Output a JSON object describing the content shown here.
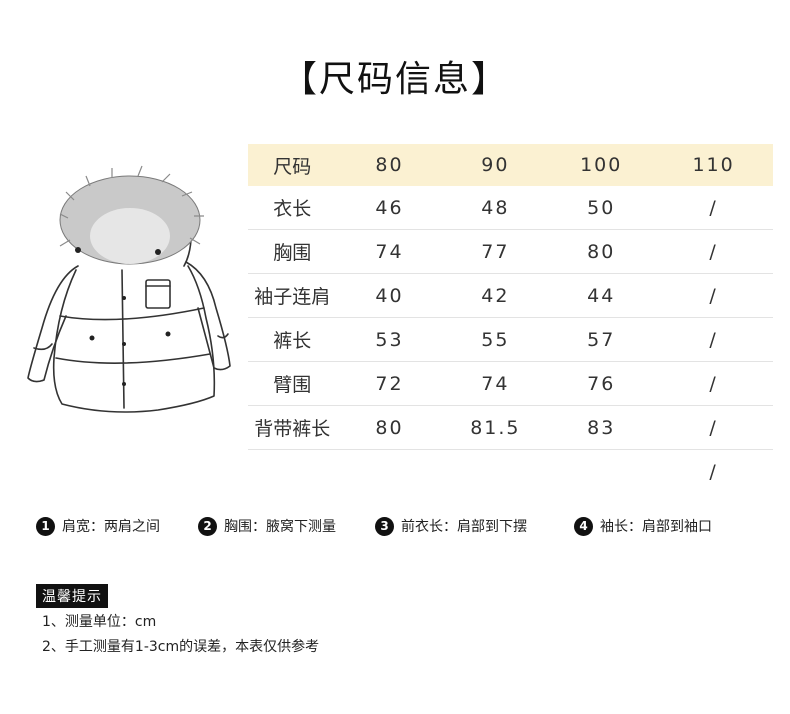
{
  "title": "【尺码信息】",
  "table": {
    "header": {
      "label": "尺码",
      "values": [
        "80",
        "90",
        "100",
        "110"
      ]
    },
    "rows": [
      {
        "label": "衣长",
        "values": [
          "46",
          "48",
          "50",
          "/"
        ]
      },
      {
        "label": "胸围",
        "values": [
          "74",
          "77",
          "80",
          "/"
        ]
      },
      {
        "label": "袖子连肩",
        "values": [
          "40",
          "42",
          "44",
          "/"
        ]
      },
      {
        "label": "裤长",
        "values": [
          "53",
          "55",
          "57",
          "/"
        ]
      },
      {
        "label": "臂围",
        "values": [
          "72",
          "74",
          "76",
          "/"
        ]
      },
      {
        "label": "背带裤长",
        "values": [
          "80",
          "81.5",
          "83",
          "/"
        ]
      },
      {
        "label": "",
        "values": [
          "",
          "",
          "",
          "/"
        ]
      }
    ],
    "header_bg": "#fbf1d2"
  },
  "measure_notes": [
    {
      "num": "1",
      "text": "肩宽：两肩之间"
    },
    {
      "num": "2",
      "text": "胸围：腋窝下测量"
    },
    {
      "num": "3",
      "text": "前衣长：肩部到下摆"
    },
    {
      "num": "4",
      "text": "袖长：肩部到袖口"
    }
  ],
  "tips": {
    "label": "温馨提示",
    "lines": [
      "1、测量单位：cm",
      "2、手工测量有1-3cm的误差，本表仅供参考"
    ]
  },
  "image": {
    "icon": "hooded-coat-illustration"
  }
}
